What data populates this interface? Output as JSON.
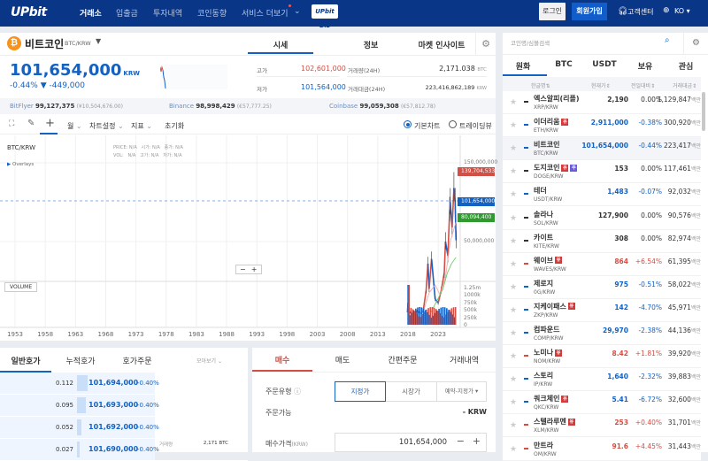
{
  "header": {
    "logo": "UPbit",
    "nav": [
      "거래소",
      "입출금",
      "투자내역",
      "코인동향",
      "서비스 더보기"
    ],
    "biz": "UPbit Biz",
    "login": "로그인",
    "join": "회원가입",
    "support": "고객센터",
    "lang": "KO"
  },
  "coin": {
    "name": "비트코인",
    "pair": "BTC/KRW",
    "tabs": [
      "시세",
      "정보",
      "마켓 인사이트"
    ],
    "price": "101,654,000",
    "unit": "KRW",
    "change_pct": "-0.44%",
    "change_amt": "▼ -449,000",
    "high_label": "고가",
    "high": "102,601,000",
    "low_label": "저가",
    "low": "101,564,000",
    "vol_label": "거래량(24H)",
    "vol": "2,171.038",
    "vol_unit": "BTC",
    "amt_label": "거래대금(24H)",
    "amt": "223,416,862,189",
    "amt_unit": "KRW",
    "exchanges": [
      {
        "name": "BitFlyer",
        "price": "99,127,375",
        "ref": "(¥10,504,676.00)"
      },
      {
        "name": "Binance",
        "price": "98,998,429",
        "ref": "(€57,777.25)"
      },
      {
        "name": "Coinbase",
        "price": "99,059,308",
        "ref": "(€57,812.78)"
      }
    ]
  },
  "toolbar": {
    "period": "월",
    "settings": "차트설정",
    "indicators": "지표",
    "reset": "초기화",
    "basic": "기본차트",
    "tradingview": "트레이딩뷰"
  },
  "chart": {
    "symbol": "BTC/KRW",
    "info1": "PRICE: N/A   시가: N/A   종가: N/A",
    "info2": "VOL:   N/A   고가: N/A   저가: N/A",
    "overlays": "Overlays",
    "volume": "VOLUME",
    "yticks": [
      "150,000,000",
      "50,000,000"
    ],
    "vticks": [
      "1.25m",
      "1000k",
      "750k",
      "500k",
      "250k",
      "0"
    ],
    "xticks": [
      "1953",
      "1958",
      "1963",
      "1968",
      "1973",
      "1978",
      "1983",
      "1988",
      "1993",
      "1998",
      "2003",
      "2008",
      "2013",
      "2018",
      "2023"
    ],
    "badges": [
      "139,704,533",
      "101,654,000",
      "80,094,400"
    ],
    "colors": {
      "up": "#d24f45",
      "down": "#1261c4",
      "ma": "#5cc85a"
    }
  },
  "orderbook": {
    "tabs": [
      "일반호가",
      "누적호가",
      "호가주문"
    ],
    "view": "모아보기",
    "rows": [
      {
        "amt": "0.112",
        "price": "101,694,000",
        "pct": "-0.40%"
      },
      {
        "amt": "0.095",
        "price": "101,693,000",
        "pct": "-0.40%"
      },
      {
        "amt": "0.052",
        "price": "101,692,000",
        "pct": "-0.40%"
      },
      {
        "amt": "0.027",
        "price": "101,690,000",
        "pct": "-0.40%"
      }
    ],
    "vol_label": "거래량",
    "vol": "2,171 BTC"
  },
  "order": {
    "tabs": [
      "매수",
      "매도",
      "간편주문",
      "거래내역"
    ],
    "type_label": "주문유형",
    "types": [
      "지정가",
      "시장가",
      "예약-지정가"
    ],
    "avail_label": "주문가능",
    "avail": "- KRW",
    "price_label": "매수가격",
    "price_unit": "(KRW)",
    "price": "101,654,000"
  },
  "market": {
    "search_placeholder": "코인명/심볼검색",
    "tabs": [
      "원화",
      "BTC",
      "USDT",
      "보유",
      "관심"
    ],
    "cols": [
      "한글명",
      "현재가",
      "전일대비",
      "거래대금"
    ],
    "unit": "백만",
    "rows": [
      {
        "name": "엑스알피(리플)",
        "sym": "XRP/KRW",
        "price": "2,190",
        "chg": "0.00%",
        "vol": "1,129,847",
        "dir": "flat"
      },
      {
        "name": "이더리움",
        "sym": "ETH/KRW",
        "price": "2,911,000",
        "chg": "-0.38%",
        "vol": "300,920",
        "dir": "down",
        "badge": "유"
      },
      {
        "name": "비트코인",
        "sym": "BTC/KRW",
        "price": "101,654,000",
        "chg": "-0.44%",
        "vol": "223,417",
        "dir": "down",
        "sel": true
      },
      {
        "name": "도지코인",
        "sym": "DOGE/KRW",
        "price": "153",
        "chg": "0.00%",
        "vol": "117,461",
        "dir": "flat",
        "badge": "유",
        "badge2": "주"
      },
      {
        "name": "테더",
        "sym": "USDT/KRW",
        "price": "1,483",
        "chg": "-0.07%",
        "vol": "92,032",
        "dir": "down"
      },
      {
        "name": "솔라나",
        "sym": "SOL/KRW",
        "price": "127,900",
        "chg": "0.00%",
        "vol": "90,576",
        "dir": "flat"
      },
      {
        "name": "카이트",
        "sym": "KITE/KRW",
        "price": "308",
        "chg": "0.00%",
        "vol": "82,974",
        "dir": "flat"
      },
      {
        "name": "웨이브",
        "sym": "WAVES/KRW",
        "price": "864",
        "chg": "+6.54%",
        "vol": "61,395",
        "dir": "up",
        "badge": "유"
      },
      {
        "name": "제로지",
        "sym": "0G/KRW",
        "price": "975",
        "chg": "-0.51%",
        "vol": "58,022",
        "dir": "down"
      },
      {
        "name": "지케이패스",
        "sym": "ZKP/KRW",
        "price": "142",
        "chg": "-4.70%",
        "vol": "45,971",
        "dir": "down",
        "badge": "유"
      },
      {
        "name": "컴파운드",
        "sym": "COMP/KRW",
        "price": "29,970",
        "chg": "-2.38%",
        "vol": "44,136",
        "dir": "down"
      },
      {
        "name": "노미나",
        "sym": "NOM/KRW",
        "price": "8.42",
        "chg": "+1.81%",
        "vol": "39,920",
        "dir": "up",
        "badge": "유"
      },
      {
        "name": "스토리",
        "sym": "IP/KRW",
        "price": "1,640",
        "chg": "-2.32%",
        "vol": "39,883",
        "dir": "down"
      },
      {
        "name": "쿼크체인",
        "sym": "QKC/KRW",
        "price": "5.41",
        "chg": "-6.72%",
        "vol": "32,600",
        "dir": "down",
        "badge": "유"
      },
      {
        "name": "스텔라루멘",
        "sym": "XLM/KRW",
        "price": "253",
        "chg": "+0.40%",
        "vol": "31,701",
        "dir": "up",
        "badge": "유"
      },
      {
        "name": "만트라",
        "sym": "OM/KRW",
        "price": "91.6",
        "chg": "+4.45%",
        "vol": "31,443",
        "dir": "up"
      }
    ]
  }
}
